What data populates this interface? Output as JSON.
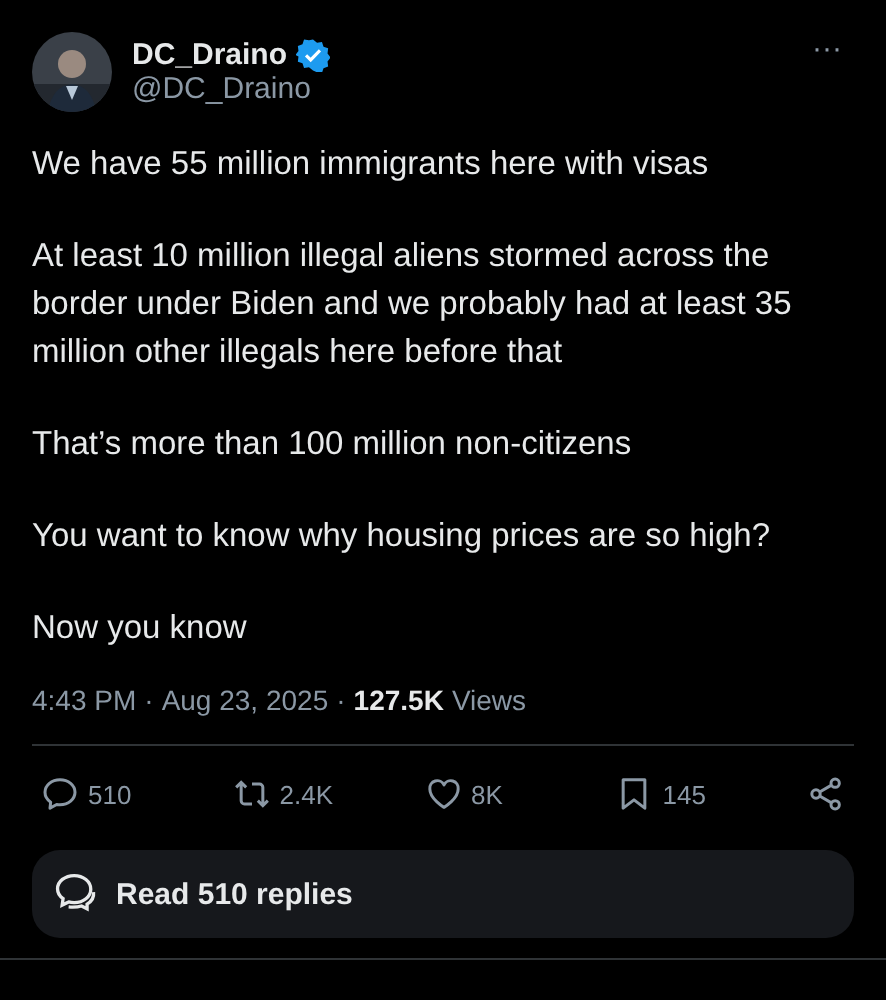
{
  "author": {
    "name": "DC_Draino",
    "verified": true,
    "handle": "@DC_Draino"
  },
  "menu": "···",
  "paragraphs": [
    "We have 55 million immigrants here with visas",
    "At least 10 million illegal aliens stormed across the border under Biden and we probably had at least 35 million other illegals here before that",
    "That’s more than 100 million non-citizens",
    "You want to know why housing prices are so high?",
    "Now you know"
  ],
  "meta": {
    "time": "4:43 PM",
    "separator_1": "·",
    "date": "Aug 23, 2025",
    "separator_2": "·",
    "views_count": "127.5K",
    "views_label": "Views"
  },
  "actions": [
    {
      "kind": "reply",
      "count": "510"
    },
    {
      "kind": "repost",
      "count": "2.4K"
    },
    {
      "kind": "like",
      "count": "8K"
    },
    {
      "kind": "bookmark",
      "count": "145"
    },
    {
      "kind": "share"
    }
  ],
  "read_replies": "Read 510 replies"
}
